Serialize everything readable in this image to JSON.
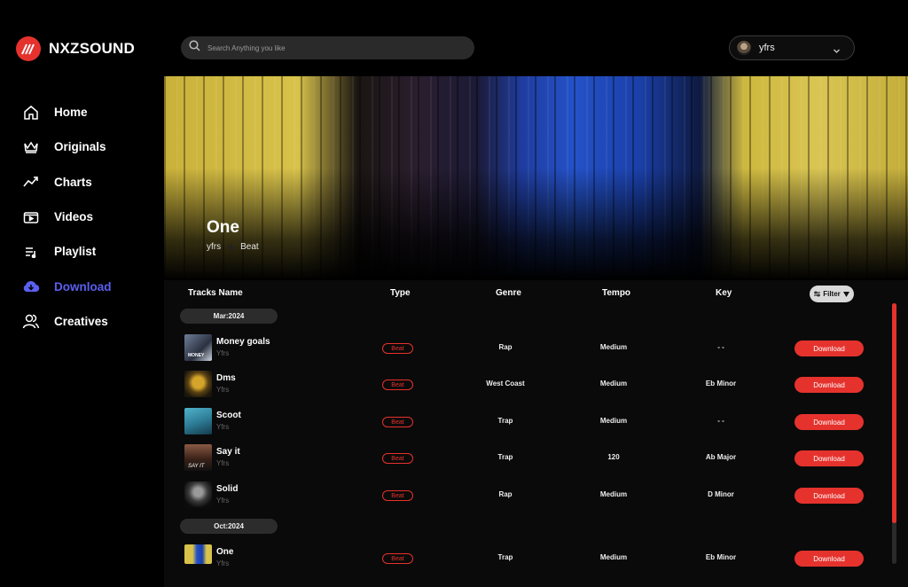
{
  "brand": {
    "name": "NXZSOUND",
    "accent": "#e5322d",
    "active_nav": "#5b5ff0"
  },
  "sidebar": {
    "items": [
      {
        "label": "Home",
        "icon": "home-icon"
      },
      {
        "label": "Originals",
        "icon": "crown-icon"
      },
      {
        "label": "Charts",
        "icon": "trend-icon"
      },
      {
        "label": "Videos",
        "icon": "video-icon"
      },
      {
        "label": "Playlist",
        "icon": "playlist-icon"
      },
      {
        "label": "Download",
        "icon": "cloud-download-icon",
        "active": true
      },
      {
        "label": "Creatives",
        "icon": "users-icon"
      }
    ]
  },
  "search": {
    "placeholder": "Search Anything you like"
  },
  "user": {
    "name": "yfrs"
  },
  "hero": {
    "title": "One",
    "artist": "yfrs",
    "type": "Beat"
  },
  "table": {
    "headers": {
      "name": "Tracks Name",
      "type": "Type",
      "genre": "Genre",
      "tempo": "Tempo",
      "key": "Key"
    },
    "filter_label": "Filter",
    "download_label": "Download",
    "groups": [
      {
        "label": "Mar:2024",
        "rows": [
          {
            "name": "Money goals",
            "artist": "Yfrs",
            "type": "Beat",
            "genre": "Rap",
            "tempo": "Medium",
            "key": "- -"
          },
          {
            "name": "Dms",
            "artist": "Yfrs",
            "type": "Beat",
            "genre": "West Coast",
            "tempo": "Medium",
            "key": "Eb Minor"
          },
          {
            "name": "Scoot",
            "artist": "Yfrs",
            "type": "Beat",
            "genre": "Trap",
            "tempo": "Medium",
            "key": "- -"
          },
          {
            "name": "Say it",
            "artist": "Yfrs",
            "type": "Beat",
            "genre": "Trap",
            "tempo": "120",
            "key": "Ab Major"
          },
          {
            "name": "Solid",
            "artist": "Yfrs",
            "type": "Beat",
            "genre": "Rap",
            "tempo": "Medium",
            "key": "D Minor"
          }
        ]
      },
      {
        "label": "Oct:2024",
        "rows": [
          {
            "name": "One",
            "artist": "Yfrs",
            "type": "Beat",
            "genre": "Trap",
            "tempo": "Medium",
            "key": "Eb Minor"
          }
        ]
      }
    ]
  }
}
